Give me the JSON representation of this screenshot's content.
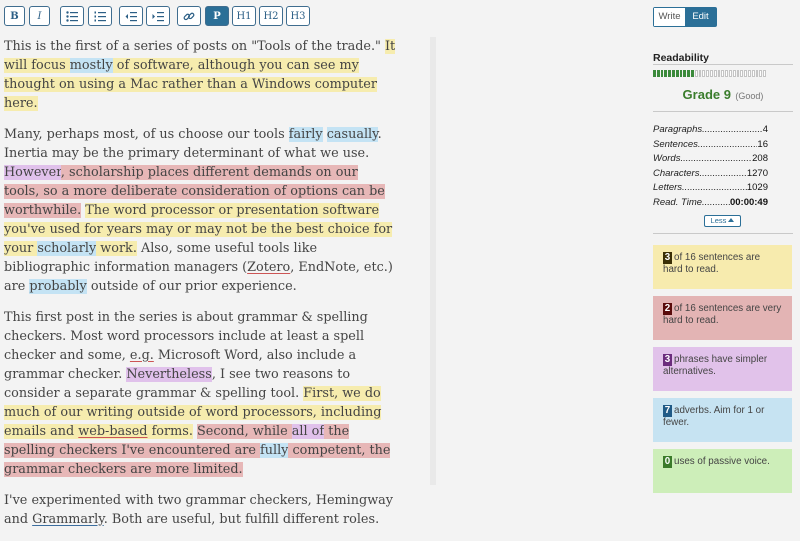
{
  "toolbar": {
    "bold": "B",
    "italic": "I",
    "paragraph": "P",
    "h1": "H1",
    "h2": "H2",
    "h3": "H3"
  },
  "mode": {
    "write": "Write",
    "edit": "Edit"
  },
  "editor": {
    "p1": [
      {
        "t": "This is the first of a series of posts on \"Tools of the trade.\" ",
        "c": ""
      },
      {
        "t": "It will focus ",
        "c": "y"
      },
      {
        "t": "mostly",
        "c": "b"
      },
      {
        "t": " of software, although you can see my thought on using a Mac rather than a Windows computer here.",
        "c": "y"
      }
    ],
    "p2": [
      {
        "t": "Many, perhaps most, of us choose our tools ",
        "c": ""
      },
      {
        "t": "fairly",
        "c": "b"
      },
      {
        "t": " ",
        "c": ""
      },
      {
        "t": "casually",
        "c": "b"
      },
      {
        "t": ".  Inertia may be the primary determinant of what we use.  ",
        "c": ""
      },
      {
        "t": "However",
        "c": "p"
      },
      {
        "t": ", scholarship places different demands on our tools, so a more deliberate consideration of options can be worthwhile.",
        "c": "r"
      },
      {
        "t": "  ",
        "c": ""
      },
      {
        "t": "The word processor or presentation software you've used for years may or may not be the best choice for your ",
        "c": "y"
      },
      {
        "t": "scholarly",
        "c": "b"
      },
      {
        "t": " work.",
        "c": "y"
      },
      {
        "t": " Also, some useful tools like bibliographic information managers (",
        "c": ""
      },
      {
        "t": "Zotero",
        "c": "ul"
      },
      {
        "t": ", EndNote, etc.) are ",
        "c": ""
      },
      {
        "t": "probably",
        "c": "b"
      },
      {
        "t": " outside of our prior experience.",
        "c": ""
      }
    ],
    "p3": [
      {
        "t": "This first post in the series is about grammar & spelling checkers. Most word processors include at least a spell checker and some, ",
        "c": ""
      },
      {
        "t": "e.g.",
        "c": "ul"
      },
      {
        "t": "  Microsoft Word, also include a grammar checker.  ",
        "c": ""
      },
      {
        "t": "Nevertheless",
        "c": "p"
      },
      {
        "t": ", I see two reasons to consider a separate grammar & spelling tool. ",
        "c": ""
      },
      {
        "t": "First, we do much of our writing outside of word processors, including emails and ",
        "c": "y"
      },
      {
        "t": "web-based",
        "c": "yul"
      },
      {
        "t": " forms.",
        "c": "y"
      },
      {
        "t": " ",
        "c": ""
      },
      {
        "t": "Second, while ",
        "c": "r"
      },
      {
        "t": "all of",
        "c": "p"
      },
      {
        "t": " the spelling checkers I've encountered are ",
        "c": "r"
      },
      {
        "t": "fully",
        "c": "b"
      },
      {
        "t": " competent, the grammar checkers are more limited.",
        "c": "r"
      }
    ],
    "p4": [
      {
        "t": "I've experimented with two grammar checkers, Hemingway and ",
        "c": ""
      },
      {
        "t": "Grammarly",
        "c": "ulb"
      },
      {
        "t": ". Both are useful, but fulfill different roles.",
        "c": ""
      }
    ]
  },
  "sidebar": {
    "readability_label": "Readability",
    "readability_level": 0.36,
    "grade": "Grade 9",
    "grade_note": "(Good)",
    "stats": [
      {
        "label": "Paragraphs",
        "value": "4"
      },
      {
        "label": "Sentences",
        "value": "16"
      },
      {
        "label": "Words",
        "value": "208"
      },
      {
        "label": "Characters",
        "value": "1270"
      },
      {
        "label": "Letters",
        "value": "1029"
      },
      {
        "label": "Read. Time",
        "value": "00:00:49"
      }
    ],
    "less_label": "Less",
    "cards": [
      {
        "num": "3",
        "text": "of 16 sentences are hard to read.",
        "bg": "#f7ebae",
        "numbg": "#3a2f05"
      },
      {
        "num": "2",
        "text": "of 16 sentences are very hard to read.",
        "bg": "#e3b4b4",
        "numbg": "#5a0c0c"
      },
      {
        "num": "3",
        "text": "phrases have simpler alternatives.",
        "bg": "#e1c2ea",
        "numbg": "#6b2c7d"
      },
      {
        "num": "7",
        "text": "adverbs. Aim for 1 or fewer.",
        "bg": "#c6e3f2",
        "numbg": "#1f5a86"
      },
      {
        "num": "0",
        "text": "uses of passive voice.",
        "bg": "#cdeeb9",
        "numbg": "#3a7a2a"
      }
    ]
  }
}
